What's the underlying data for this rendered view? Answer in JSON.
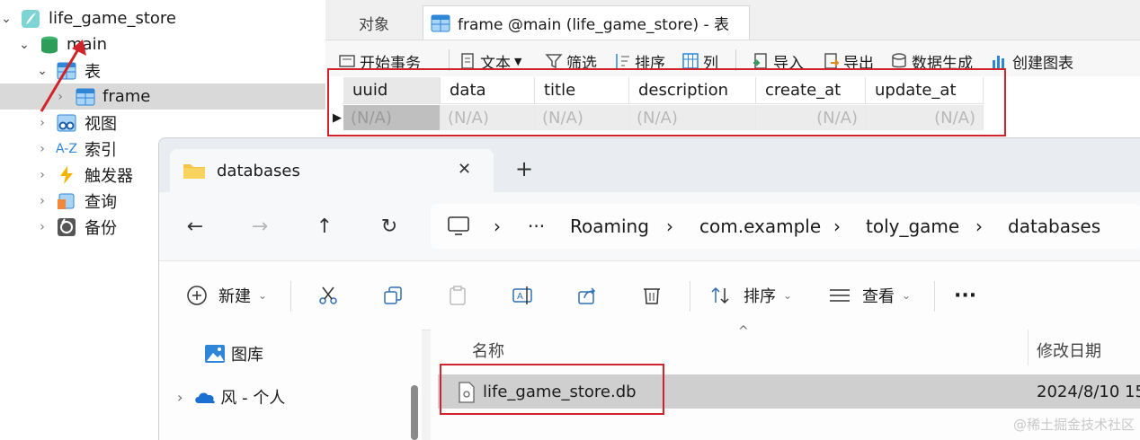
{
  "tree": {
    "db_name": "life_game_store",
    "schema_name": "main",
    "tables_label": "表",
    "table_name": "frame",
    "views_label": "视图",
    "indexes_label": "索引",
    "triggers_label": "触发器",
    "queries_label": "查询",
    "backups_label": "备份",
    "az_glyph": "A-Z"
  },
  "navicat": {
    "tab_objects": "对象",
    "tab_frame": "frame @main (life_game_store) - 表",
    "toolbar": {
      "begin_tx": "开始事务",
      "text": "文本",
      "filter": "筛选",
      "sort": "排序",
      "columns": "列",
      "import": "导入",
      "export": "导出",
      "data_gen": "数据生成",
      "create_chart": "创建图表"
    },
    "grid": {
      "columns": [
        "uuid",
        "data",
        "title",
        "description",
        "create_at",
        "update_at"
      ],
      "row": [
        "(N/A)",
        "(N/A)",
        "(N/A)",
        "(N/A)",
        "(N/A)",
        "(N/A)"
      ]
    }
  },
  "explorer": {
    "tab_title": "databases",
    "tab_close": "✕",
    "new_tab": "+",
    "breadcrumb": {
      "more": "···",
      "items": [
        "Roaming",
        "com.example",
        "toly_game",
        "databases"
      ],
      "sep": "›"
    },
    "commands": {
      "new": "新建",
      "sort": "排序",
      "view": "查看",
      "more": "···"
    },
    "nav": {
      "gallery": "图库",
      "onedrive": "风 - 个人"
    },
    "columns": {
      "name": "名称",
      "modified": "修改日期"
    },
    "file": {
      "name": "life_game_store.db",
      "modified": "2024/8/10 15"
    }
  },
  "watermark": "@稀土掘金技术社区",
  "colors": {
    "highlight_red": "#d1232a",
    "arrow_red": "#d1232a",
    "selection_gray": "#d9d9d9",
    "db_green": "#2e9d5a"
  }
}
